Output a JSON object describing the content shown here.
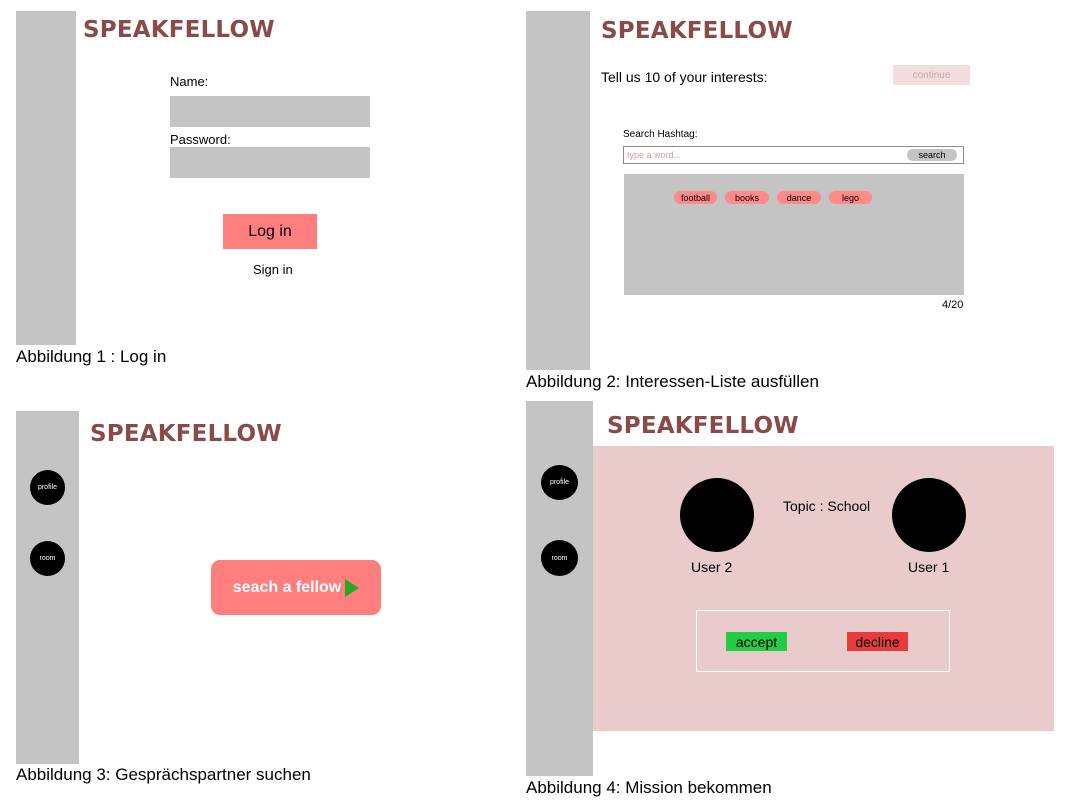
{
  "brand": "SPEAKFELLOW",
  "panel1": {
    "name_label": "Name:",
    "password_label": "Password:",
    "login_button": "Log in",
    "signin_link": "Sign in",
    "caption": "Abbildung 1 : Log in"
  },
  "panel2": {
    "interests_prompt": "Tell us 10 of your interests:",
    "continue_button": "continue",
    "search_label": "Search Hashtag:",
    "search_placeholder": "type a word...",
    "search_button": "search",
    "tags": [
      "football",
      "books",
      "dance",
      "lego"
    ],
    "counter": "4/20",
    "caption": "Abbildung 2: Interessen-Liste ausfüllen"
  },
  "panel3": {
    "profile_button": "profile",
    "room_button": "room",
    "search_fellow_button": "seach a fellow",
    "caption": "Abbildung 3: Gesprächspartner suchen"
  },
  "panel4": {
    "profile_button": "profile",
    "room_button": "room",
    "topic": "Topic : School",
    "user2": "User 2",
    "user1": "User 1",
    "accept_button": "accept",
    "decline_button": "decline",
    "caption": "Abbildung 4: Mission bekommen"
  },
  "colors": {
    "brand": "#8b4a4a",
    "primary_button": "#ff7f7f",
    "accept": "#22cc44",
    "decline": "#e63c3c",
    "mission_bg": "#e9cbcc",
    "play_icon": "#22aa22"
  }
}
